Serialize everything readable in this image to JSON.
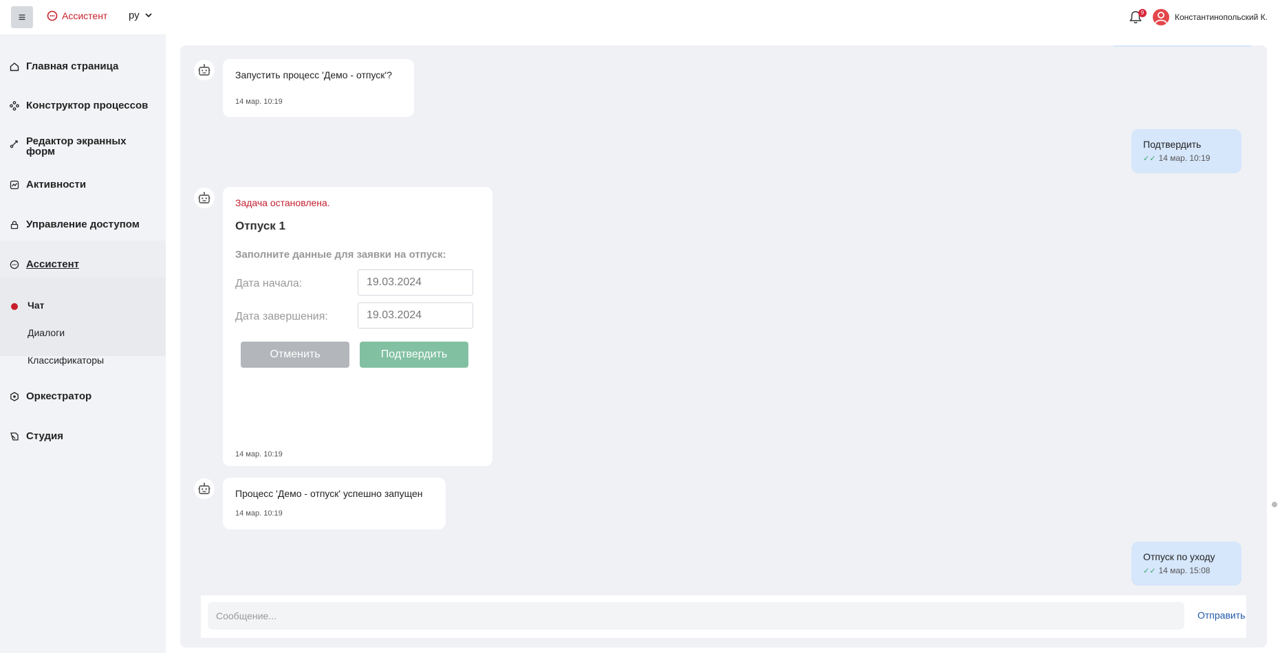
{
  "header": {
    "brand_label": "Ассистент",
    "language": "ру",
    "notifications_count": "9",
    "user_name": "Константинопольский К."
  },
  "sidebar": {
    "items": [
      {
        "label": "Главная страница",
        "icon": "home-icon"
      },
      {
        "label": "Конструктор процессов",
        "icon": "process-icon"
      },
      {
        "label": "Редактор экранных форм",
        "icon": "forms-icon"
      },
      {
        "label": "Активности",
        "icon": "activity-icon"
      },
      {
        "label": "Управление доступом",
        "icon": "lock-icon"
      },
      {
        "label": "Ассистент",
        "icon": "chat-icon"
      },
      {
        "label": "Оркестратор",
        "icon": "hexagon-icon"
      },
      {
        "label": "Студия",
        "icon": "studio-icon"
      }
    ],
    "sub_items": [
      {
        "label": "Чат"
      },
      {
        "label": "Диалоги"
      },
      {
        "label": "Классификаторы"
      }
    ]
  },
  "chat": {
    "messages": [
      {
        "from": "bot",
        "text": "Запустить процесс 'Демо - отпуск'?",
        "time": "14 мар. 10:19"
      },
      {
        "from": "user",
        "text": "Подтвердить",
        "time": "14 мар. 10:19"
      },
      {
        "from": "bot",
        "status": "Задача остановлена.",
        "title": "Отпуск 1",
        "form_subtitle": "Заполните данные для заявки на отпуск:",
        "start_label": "Дата начала:",
        "start_value": "19.03.2024",
        "end_label": "Дата завершения:",
        "end_value": "19.03.2024",
        "cancel_label": "Отменить",
        "confirm_label": "Подтвердить",
        "time": "14 мар. 10:19"
      },
      {
        "from": "bot",
        "text": "Процесс 'Демо - отпуск' успешно запущен",
        "time": "14 мар. 10:19"
      },
      {
        "from": "user",
        "text": "Отпуск по уходу",
        "time": "14 мар. 15:08"
      }
    ],
    "composer_placeholder": "Сообщение...",
    "send_label": "Отправить"
  },
  "colors": {
    "accent_red": "#c8202a",
    "user_bubble": "#d6e6fb",
    "confirm_green": "#82c0a2",
    "link_blue": "#1f56a8"
  }
}
